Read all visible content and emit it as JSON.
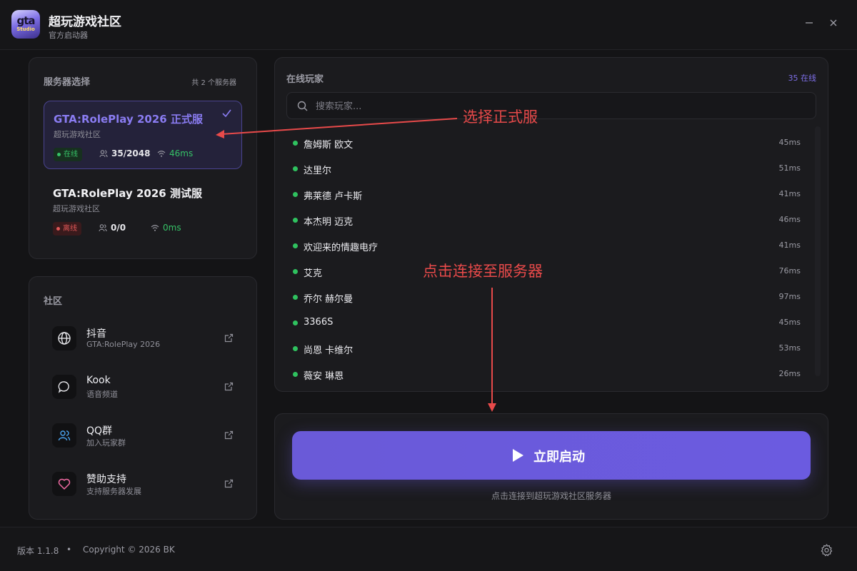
{
  "app": {
    "title": "超玩游戏社区",
    "subtitle": "官方启动器",
    "logo_main": "gta",
    "logo_sub": "Studio"
  },
  "window": {
    "minimize_icon": "minimize-icon",
    "close_icon": "close-icon"
  },
  "servers": {
    "label": "服务器选择",
    "count_text": "共 2 个服务器",
    "items": [
      {
        "name": "GTA:RolePlay 2026 正式服",
        "org": "超玩游戏社区",
        "status": "在线",
        "players": "35/2048",
        "ping": "46ms",
        "selected": true
      },
      {
        "name": "GTA:RolePlay 2026 测试服",
        "org": "超玩游戏社区",
        "status": "离线",
        "players": "0/0",
        "ping": "0ms",
        "selected": false
      }
    ]
  },
  "community": {
    "label": "社区",
    "items": [
      {
        "title": "抖音",
        "sub": "GTA:RolePlay 2026",
        "icon": "globe-icon"
      },
      {
        "title": "Kook",
        "sub": "语音频道",
        "icon": "chat-bubble-icon"
      },
      {
        "title": "QQ群",
        "sub": "加入玩家群",
        "icon": "users-icon"
      },
      {
        "title": "赞助支持",
        "sub": "支持服务器发展",
        "icon": "heart-icon"
      }
    ]
  },
  "players": {
    "label": "在线玩家",
    "online_text": "35 在线",
    "search_placeholder": "搜索玩家...",
    "list": [
      {
        "name": "詹姆斯 欧文",
        "ping": "45ms"
      },
      {
        "name": "达里尔",
        "ping": "51ms"
      },
      {
        "name": "弗莱德 卢卡斯",
        "ping": "41ms"
      },
      {
        "name": "本杰明 迈克",
        "ping": "46ms"
      },
      {
        "name": "欢迎来的情趣电疗",
        "ping": "41ms"
      },
      {
        "name": "艾克",
        "ping": "76ms"
      },
      {
        "name": "乔尔 赫尔曼",
        "ping": "97ms"
      },
      {
        "name": "3366S",
        "ping": "45ms"
      },
      {
        "name": "尚恩 卡维尔",
        "ping": "53ms"
      },
      {
        "name": "薇安 琳恩",
        "ping": "26ms"
      }
    ]
  },
  "launch": {
    "label": "立即启动",
    "note": "点击连接到超玩游戏社区服务器"
  },
  "footer": {
    "version": "版本 1.1.8",
    "separator": "•",
    "copyright": "Copyright © 2026 BK"
  },
  "annotations": {
    "select_server": "选择正式服",
    "click_connect": "点击连接至服务器"
  },
  "colors": {
    "accent": "#6a5ad8",
    "online": "#2fc25f",
    "offline": "#e05858",
    "annotation": "#e84a4a"
  }
}
